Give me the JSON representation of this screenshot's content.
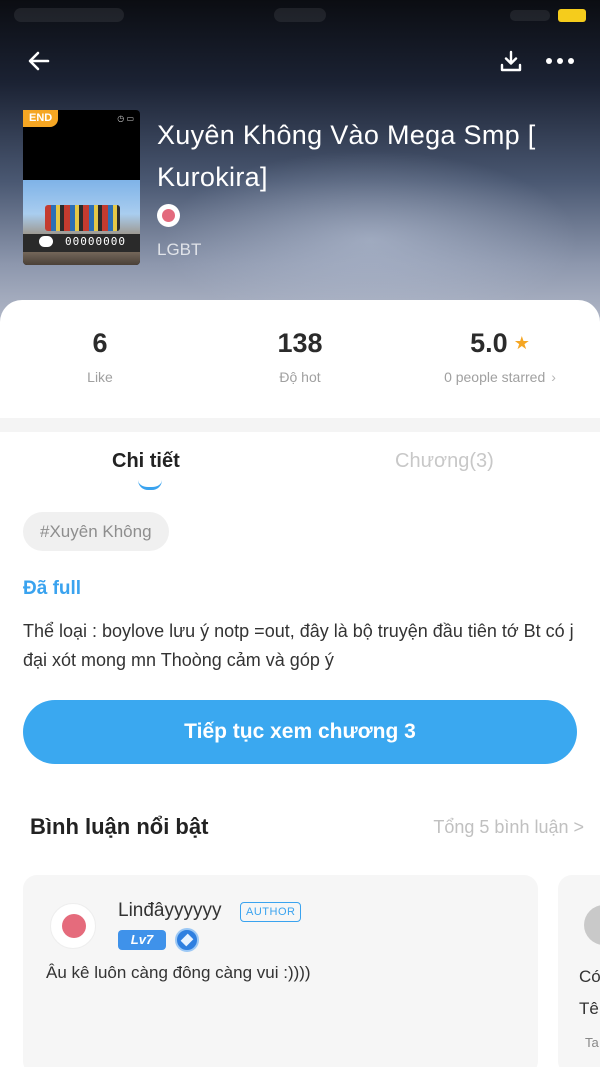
{
  "book": {
    "title": "Xuyên Không Vào Mega Smp [ Kurokira]",
    "badge": "END",
    "genre": "LGBT",
    "cover_counter": "00000000"
  },
  "stats": {
    "likes": {
      "value": "6",
      "label": "Like"
    },
    "hot": {
      "value": "138",
      "label": "Độ hot"
    },
    "rating": {
      "value": "5.0",
      "label": "0 people starred"
    }
  },
  "tabs": {
    "detail": "Chi tiết",
    "chapters": "Chương(3)"
  },
  "tag": "#Xuyên Không",
  "status": "Đã full",
  "description": "Thể loại : boylove lưu ý notp =out, đây là bộ truyện đầu tiên tớ Bt có j đại xót mong mn Thoòng cảm và góp ý",
  "continue_button": "Tiếp tục xem chương 3",
  "comments": {
    "title": "Bình luận nổi bật",
    "total": "Tổng 5 bình luận >",
    "items": [
      {
        "username": "Linđâyyyyyy",
        "badge": "AUTHOR",
        "level": "Lv7",
        "text": "Âu kê luôn càng đông càng vui :))))"
      },
      {
        "line1": "Có",
        "line2": "Tê",
        "line3": "Ta"
      }
    ]
  },
  "colors": {
    "accent": "#3aa3ef",
    "star": "#f5a623",
    "end_badge": "#f5a623"
  },
  "icons": [
    "back-arrow-icon",
    "download-icon",
    "more-icon",
    "star-icon",
    "chevron-right-icon",
    "medal-icon"
  ]
}
